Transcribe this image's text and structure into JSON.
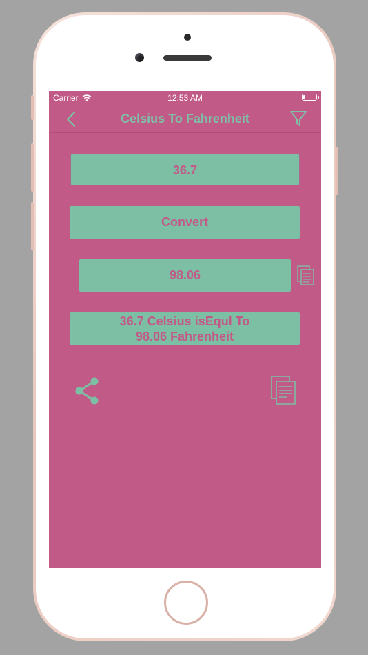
{
  "status_bar": {
    "carrier": "Carrier",
    "time": "12:53 AM",
    "battery_level_fraction": 0.15
  },
  "nav": {
    "title": "Celsius To Fahrenheit",
    "back_icon": "chevron-left-icon",
    "filter_icon": "filter-icon"
  },
  "converter": {
    "input_value": "36.7",
    "convert_label": "Convert",
    "result_value": "98.06",
    "sentence_line1": "36.7 Celsius isEqul To",
    "sentence_line2": "98.06 Fahrenheit"
  },
  "actions": {
    "share_icon": "share-icon",
    "copy_icon": "copy-icon"
  },
  "colors": {
    "background": "#c25a87",
    "accent": "#7dbfa5",
    "title": "#7dc1a7",
    "text_on_accent": "#c25a87"
  }
}
